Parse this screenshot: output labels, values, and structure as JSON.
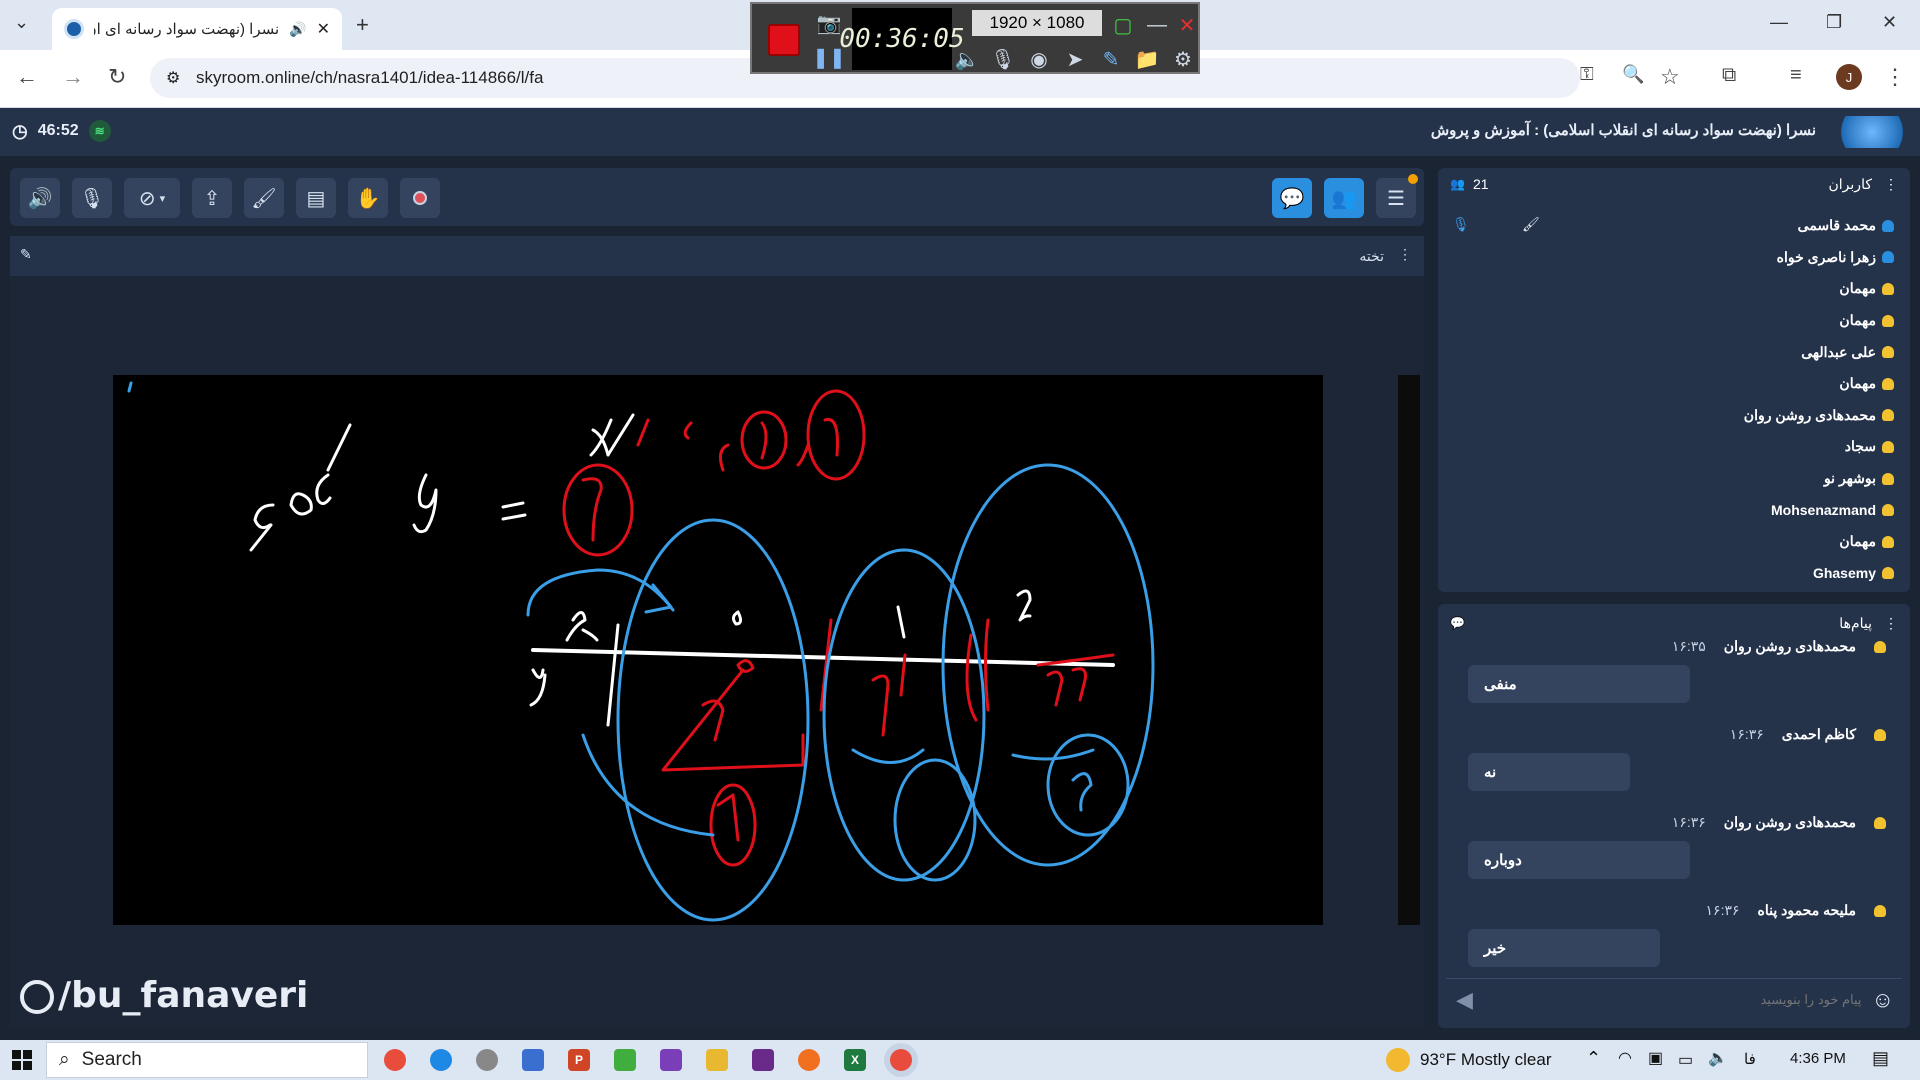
{
  "browser": {
    "tab_title": "نسرا (نهضت سواد رسانه ای ان",
    "url": "skyroom.online/ch/nasra1401/idea-114866/l/fa",
    "new_tab_label": "+",
    "profile_initial": "J"
  },
  "recorder": {
    "elapsed": "00:36:05",
    "resolution": "1920 × 1080"
  },
  "app": {
    "session_timer": "46:52",
    "room_title": "نسرا (نهضت سواد رسانه ای انقلاب اسلامی) : آموزش و پروش",
    "board_title": "تخته",
    "watermark": "/bu_fanaveri"
  },
  "users": {
    "title": "کاربران",
    "count": "21",
    "items": [
      {
        "name": "محمد قاسمی",
        "color": "#2b8fe0"
      },
      {
        "name": "زهرا ناصری خواه",
        "color": "#2b8fe0"
      },
      {
        "name": "مهمان",
        "color": "#f2c230"
      },
      {
        "name": "مهمان",
        "color": "#f2c230"
      },
      {
        "name": "علی عبدالهی",
        "color": "#f2c230"
      },
      {
        "name": "مهمان",
        "color": "#f2c230"
      },
      {
        "name": "محمدهادی روشن روان",
        "color": "#f2c230"
      },
      {
        "name": "سجاد",
        "color": "#f2c230"
      },
      {
        "name": "بوشهر نو",
        "color": "#f2c230"
      },
      {
        "name": "Mohsenazmand",
        "color": "#f2c230"
      },
      {
        "name": "مهمان",
        "color": "#f2c230"
      },
      {
        "name": "Ghasemy",
        "color": "#f2c230"
      }
    ]
  },
  "messages": {
    "title": "پیام‌ها",
    "items": [
      {
        "sender": "محمدهادی روشن روان",
        "time": "۱۶:۳۵",
        "text": "منفی"
      },
      {
        "sender": "کاظم احمدی",
        "time": "۱۶:۳۶",
        "text": "نه"
      },
      {
        "sender": "محمدهادی روشن روان",
        "time": "۱۶:۳۶",
        "text": "دوباره"
      },
      {
        "sender": "ملیحه محمود پناه",
        "time": "۱۶:۳۶",
        "text": "خیر"
      }
    ],
    "input_placeholder": "پیام خود را بنویسید"
  },
  "taskbar": {
    "search_label": "Search",
    "weather": "93°F  Mostly clear",
    "lang": "فا",
    "clock": "4:36 PM"
  },
  "colors": {
    "accent": "#2b8fe0",
    "panel": "#24324a",
    "record": "#e0101a",
    "ink_red": "#e0101a",
    "ink_blue": "#3b9fe8",
    "ink_white": "#ffffff"
  }
}
